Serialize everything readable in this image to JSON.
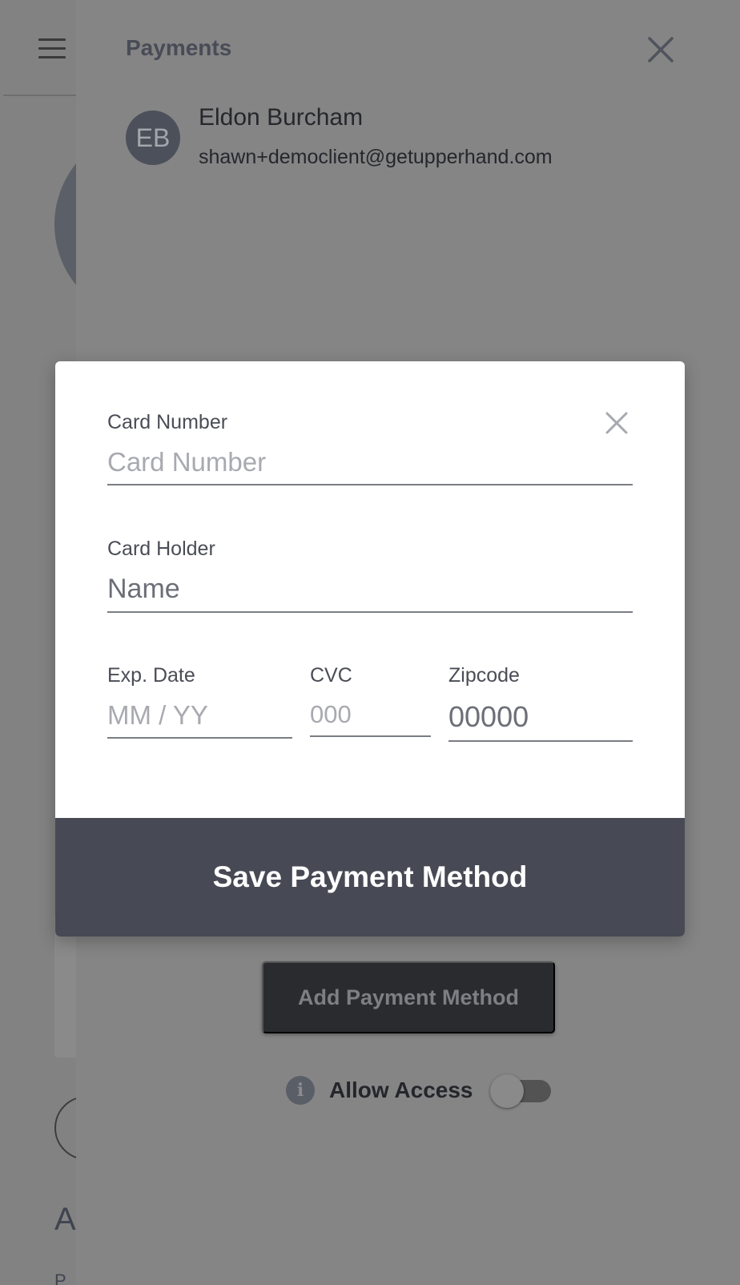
{
  "drawer": {
    "title": "Payments",
    "client": {
      "initials": "EB",
      "name": "Eldon Burcham",
      "email": "shawn+democlient@getupperhand.com"
    },
    "add_payment_label": "Add Payment Method",
    "allow_access_label": "Allow Access",
    "allow_access_enabled": false
  },
  "background": {
    "partial_text_1": "A",
    "partial_text_2": "P"
  },
  "modal": {
    "card_number": {
      "label": "Card Number",
      "placeholder": "Card Number",
      "value": ""
    },
    "card_holder": {
      "label": "Card Holder",
      "placeholder": "Name",
      "value": ""
    },
    "exp_date": {
      "label": "Exp. Date",
      "placeholder": "MM / YY",
      "value": ""
    },
    "cvc": {
      "label": "CVC",
      "placeholder": "000",
      "value": ""
    },
    "zipcode": {
      "label": "Zipcode",
      "placeholder": "00000",
      "value": ""
    },
    "save_label": "Save Payment Method"
  },
  "colors": {
    "overlay": "#7f7f7f",
    "save_button": "#474a54",
    "add_button": "#2a2b2f"
  }
}
